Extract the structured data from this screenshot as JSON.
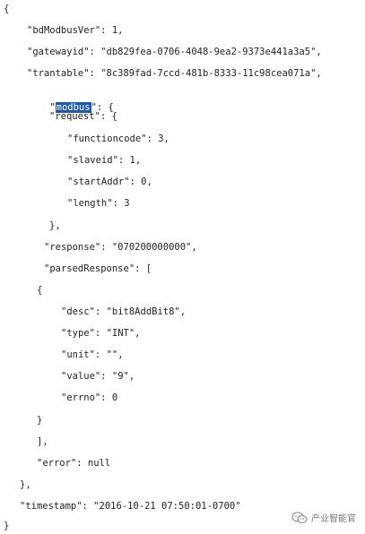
{
  "lines": [
    "{",
    "\"bdModbusVer\": 1,",
    "\"gatewayid\": \"db829fea-0706-4048-9ea2-9373e441a3a5\",",
    "\"trantable\": \"8c389fad-7ccd-481b-8333-11c98cea071a\",",
    "\": {",
    "\"request\": {",
    "\"functioncode\": 3,",
    "\"slaveid\": 1,",
    "\"startAddr\": 0,",
    "\"length\": 3",
    "},",
    "\"response\": \"070200000000\",",
    "\"parsedResponse\": [",
    "{",
    "\"desc\": \"bit8AddBit8\",",
    "\"type\": \"INT\",",
    "\"unit\": \"\",",
    "\"value\": \"9\",",
    "\"errno\": 0",
    "}",
    "],",
    "\"error\": null",
    "},",
    "\"timestamp\": \"2016-10-21 07:50:01-0700\"",
    "}"
  ],
  "modbus_quote_open": "\"",
  "modbus_key_highlighted": "modbus",
  "highlight_color": "#1f5aa8",
  "watermark": {
    "icon": "wechat-icon",
    "label": "产业智能官"
  }
}
